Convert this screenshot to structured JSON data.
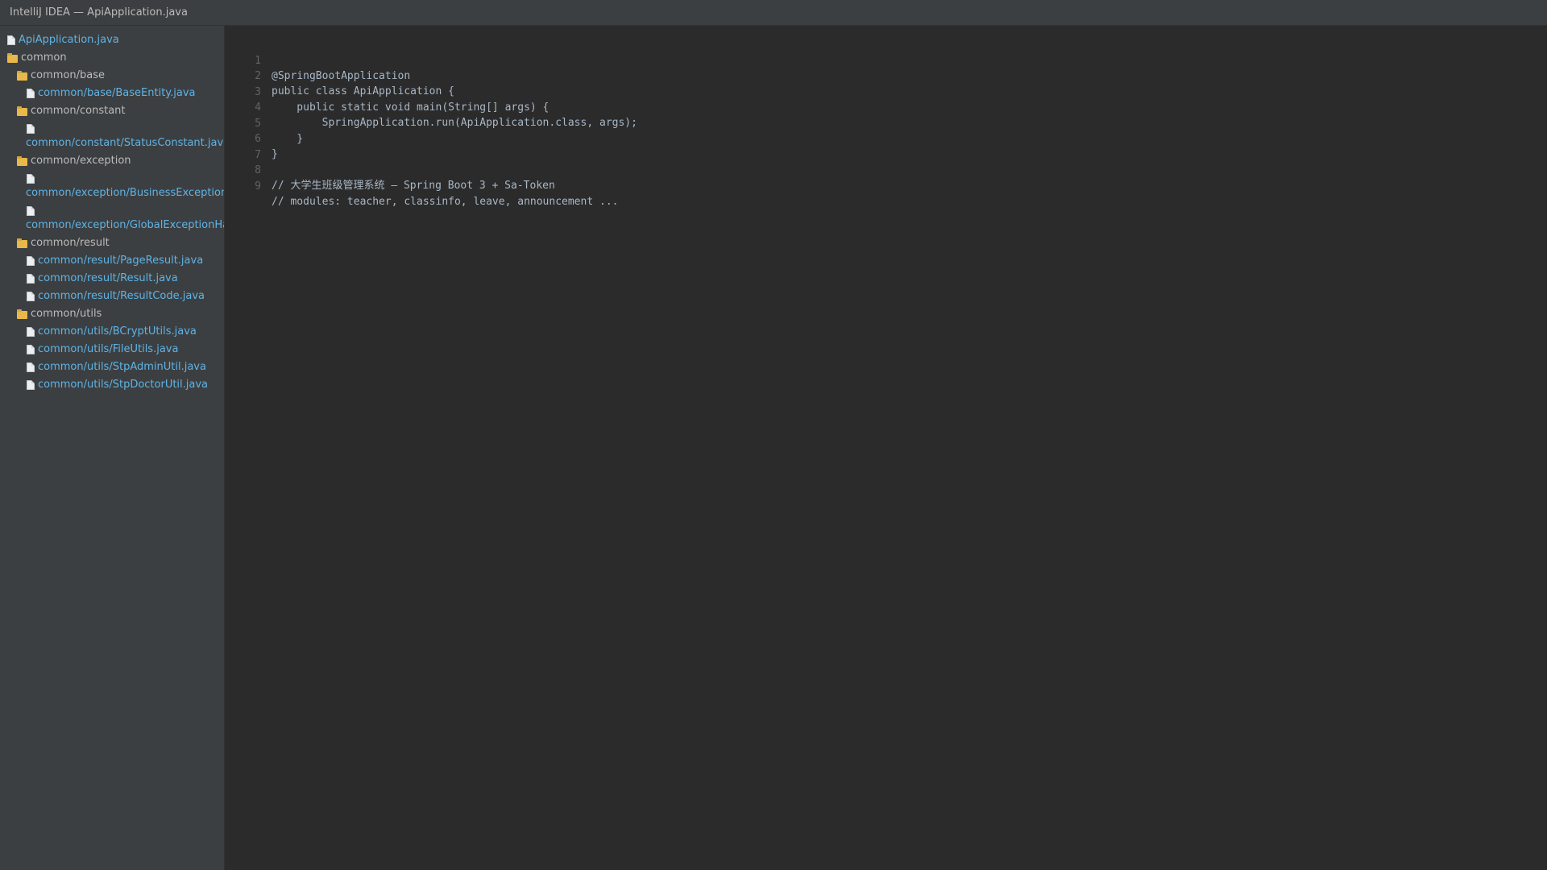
{
  "window": {
    "title": "IntelliJ IDEA — ApiApplication.java"
  },
  "sidebar": {
    "items": [
      {
        "type": "file",
        "label": "ApiApplication.java",
        "icon": "file-icon"
      },
      {
        "type": "folder",
        "label": "common",
        "icon": "folder-icon"
      },
      {
        "type": "folder",
        "label": "common/base",
        "icon": "folder-icon"
      },
      {
        "type": "file",
        "label": "common/base/BaseEntity.java",
        "icon": "file-icon"
      },
      {
        "type": "folder",
        "label": "common/constant",
        "icon": "folder-icon"
      },
      {
        "type": "file",
        "label": "common/constant/StatusConstant.java",
        "icon": "file-icon"
      },
      {
        "type": "folder",
        "label": "common/exception",
        "icon": "folder-icon"
      },
      {
        "type": "file",
        "label": "common/exception/BusinessException.java",
        "icon": "file-icon"
      },
      {
        "type": "file",
        "label": "common/exception/GlobalExceptionHandler.java",
        "icon": "file-icon"
      },
      {
        "type": "folder",
        "label": "common/result",
        "icon": "folder-icon"
      },
      {
        "type": "file",
        "label": "common/result/PageResult.java",
        "icon": "file-icon"
      },
      {
        "type": "file",
        "label": "common/result/Result.java",
        "icon": "file-icon"
      },
      {
        "type": "file",
        "label": "common/result/ResultCode.java",
        "icon": "file-icon"
      },
      {
        "type": "folder",
        "label": "common/utils",
        "icon": "folder-icon"
      },
      {
        "type": "file",
        "label": "common/utils/BCryptUtils.java",
        "icon": "file-icon"
      },
      {
        "type": "file",
        "label": "common/utils/FileUtils.java",
        "icon": "file-icon"
      },
      {
        "type": "file",
        "label": "common/utils/StpAdminUtil.java",
        "icon": "file-icon"
      },
      {
        "type": "file",
        "label": "common/utils/StpDoctorUtil.java",
        "icon": "file-icon"
      }
    ]
  },
  "editor": {
    "lines": [
      {
        "n": "1",
        "text": "@SpringBootApplication"
      },
      {
        "n": "2",
        "text": "public class ApiApplication {"
      },
      {
        "n": "3",
        "text": "    public static void main(String[] args) {"
      },
      {
        "n": "4",
        "text": "        SpringApplication.run(ApiApplication.class, args);"
      },
      {
        "n": "5",
        "text": "    }"
      },
      {
        "n": "6",
        "text": "}"
      },
      {
        "n": "7",
        "text": ""
      },
      {
        "n": "8",
        "text": "// 大学生班级管理系统 — Spring Boot 3 + Sa-Token"
      },
      {
        "n": "9",
        "text": "// modules: teacher, classinfo, leave, announcement ..."
      }
    ]
  },
  "colors": {
    "background": "#2b2b2b",
    "sidebar": "#3c3f41",
    "file_label": "#5fb3e6",
    "folder_label": "#bbbbbb",
    "code_text": "#a9b7c6",
    "line_number": "#606366"
  }
}
